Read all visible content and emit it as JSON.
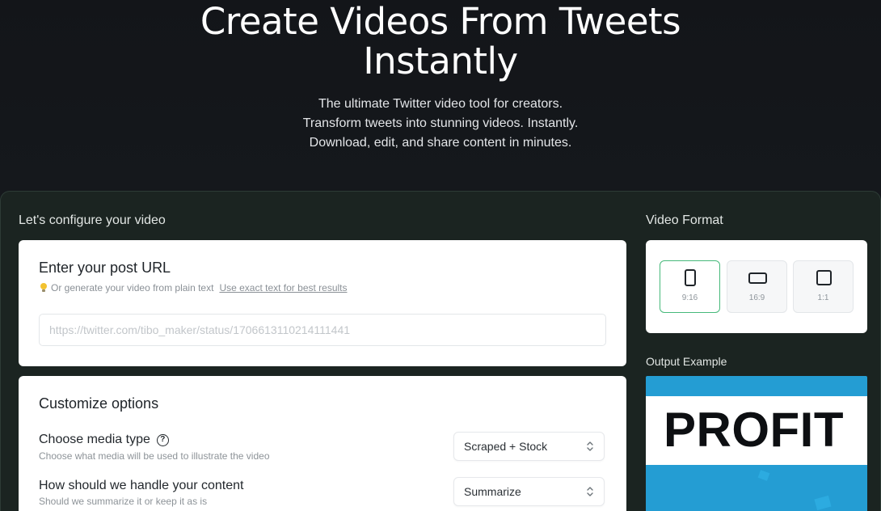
{
  "hero": {
    "title_line1": "Create Videos From Tweets",
    "title_line2": "Instantly",
    "subtitle": [
      "The ultimate Twitter video tool for creators.",
      "Transform tweets into stunning videos. Instantly.",
      "Download, edit, and share content in minutes."
    ]
  },
  "config": {
    "section_label": "Let's configure your video",
    "url_card": {
      "title": "Enter your post URL",
      "hint_text": "Or generate your video from plain text",
      "hint_link": "Use exact text for best results",
      "input_placeholder": "https://twitter.com/tibo_maker/status/1706613110214111441",
      "input_value": ""
    },
    "options_card": {
      "title": "Customize options",
      "media_type": {
        "label": "Choose media type",
        "description": "Choose what media will be used to illustrate the video",
        "value": "Scraped + Stock"
      },
      "content_handling": {
        "label": "How should we handle your content",
        "description": "Should we summarize it or keep it as is",
        "value": "Summarize"
      }
    }
  },
  "video_format": {
    "section_label": "Video Format",
    "options": [
      {
        "label": "9:16",
        "selected": true
      },
      {
        "label": "16:9",
        "selected": false
      },
      {
        "label": "1:1",
        "selected": false
      }
    ]
  },
  "output_example": {
    "section_label": "Output Example",
    "preview_text": "PROFIT"
  },
  "colors": {
    "background": "#15181c",
    "panel": "#1b2421",
    "accent_selected": "#46b97a",
    "preview_blue": "#249dd3"
  }
}
